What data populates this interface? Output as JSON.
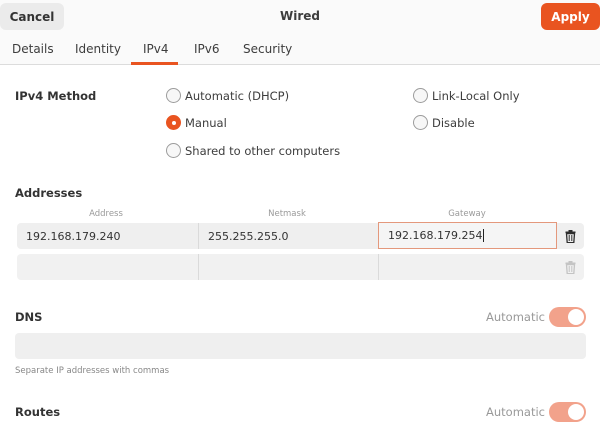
{
  "header": {
    "cancel_label": "Cancel",
    "title": "Wired",
    "apply_label": "Apply"
  },
  "tabs": [
    {
      "label": "Details"
    },
    {
      "label": "Identity"
    },
    {
      "label": "IPv4",
      "active": true
    },
    {
      "label": "IPv6"
    },
    {
      "label": "Security"
    }
  ],
  "ipv4_method": {
    "label": "IPv4 Method",
    "options": [
      {
        "label": "Automatic (DHCP)",
        "selected": false
      },
      {
        "label": "Link-Local Only",
        "selected": false
      },
      {
        "label": "Manual",
        "selected": true
      },
      {
        "label": "Disable",
        "selected": false
      },
      {
        "label": "Shared to other computers",
        "selected": false
      }
    ]
  },
  "addresses": {
    "label": "Addresses",
    "columns": [
      "Address",
      "Netmask",
      "Gateway"
    ],
    "rows": [
      {
        "address": "192.168.179.240",
        "netmask": "255.255.255.0",
        "gateway": "192.168.179.254"
      },
      {
        "address": "",
        "netmask": "",
        "gateway": ""
      }
    ]
  },
  "dns": {
    "label": "DNS",
    "automatic_label": "Automatic",
    "automatic_on": true,
    "value": "",
    "hint": "Separate IP addresses with commas"
  },
  "routes": {
    "label": "Routes",
    "automatic_label": "Automatic",
    "automatic_on": true
  },
  "colors": {
    "accent": "#e95420",
    "switch_on": "#f2a28b"
  }
}
